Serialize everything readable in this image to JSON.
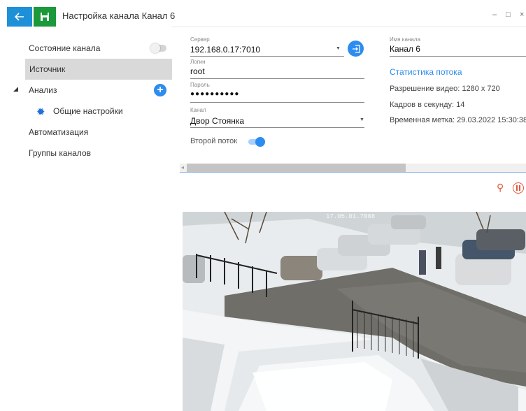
{
  "window": {
    "title": "Настройка канала Канал 6",
    "controls": [
      "–",
      "□",
      "×"
    ]
  },
  "sidebar": {
    "items": [
      {
        "label": "Состояние канала"
      },
      {
        "label": "Источник"
      },
      {
        "label": "Анализ"
      },
      {
        "label": "Общие настройки"
      },
      {
        "label": "Автоматизация"
      },
      {
        "label": "Группы каналов"
      }
    ]
  },
  "form": {
    "server_label": "Сервер",
    "server_value": "192.168.0.17:7010",
    "login_label": "Логин",
    "login_value": "root",
    "password_label": "Пароль",
    "password_value": "●●●●●●●●●●",
    "channel_label": "Канал",
    "channel_value": "Двор Стоянка",
    "second_stream_label": "Второй поток",
    "second_stream_on": true
  },
  "info": {
    "channel_name_label": "Имя канала",
    "channel_name_value": "Канал 6",
    "stats_title": "Статистика потока",
    "resolution": "Разрешение видео: 1280 x 720",
    "fps": "Кадров в секунду:  14",
    "timestamp": "Временная метка: 29.03.2022 15:30:38"
  },
  "video": {
    "overlay": "17.05.01.7088"
  },
  "colors": {
    "accent": "#2d8cef",
    "save_green": "#1a9a3a",
    "back_blue": "#1e90d8",
    "selected_bg": "#d9d9d9",
    "video_controls": "#e4573d"
  },
  "icons": [
    "back-arrow-icon",
    "save-icon",
    "minimize-icon",
    "maximize-icon",
    "close-icon",
    "plus-icon",
    "gear-icon",
    "connect-icon",
    "zoom-icon",
    "pause-icon",
    "dropdown-caret-icon"
  ]
}
